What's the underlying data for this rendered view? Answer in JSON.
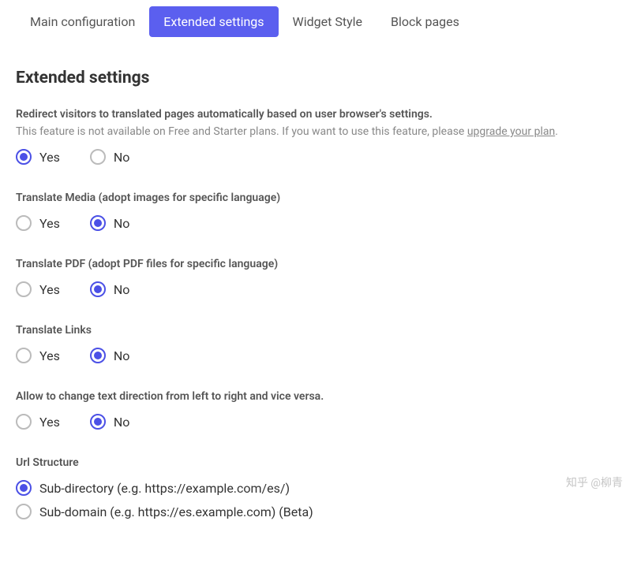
{
  "tabs": [
    {
      "label": "Main configuration",
      "active": false
    },
    {
      "label": "Extended settings",
      "active": true
    },
    {
      "label": "Widget Style",
      "active": false
    },
    {
      "label": "Block pages",
      "active": false
    }
  ],
  "section_title": "Extended settings",
  "yes": "Yes",
  "no": "No",
  "fields": {
    "redirect": {
      "label": "Redirect visitors to translated pages automatically based on user browser's settings.",
      "note_prefix": "This feature is not available on Free and Starter plans. If you want to use this feature, please ",
      "note_link": "upgrade your plan",
      "note_suffix": ".",
      "value": "yes"
    },
    "media": {
      "label": "Translate Media (adopt images for specific language)",
      "value": "no"
    },
    "pdf": {
      "label": "Translate PDF (adopt PDF files for specific language)",
      "value": "no"
    },
    "links": {
      "label": "Translate Links",
      "value": "no"
    },
    "direction": {
      "label": "Allow to change text direction from left to right and vice versa.",
      "value": "no"
    },
    "url": {
      "label": "Url Structure",
      "options": [
        {
          "label": "Sub-directory (e.g. https://example.com/es/)",
          "selected": true
        },
        {
          "label": "Sub-domain (e.g. https://es.example.com) (Beta)",
          "selected": false
        }
      ]
    }
  },
  "watermark": "知乎 @柳青"
}
